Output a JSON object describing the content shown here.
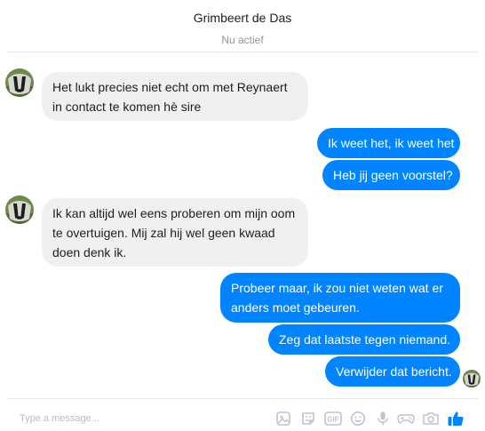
{
  "header": {
    "title": "Grimbeert de Das",
    "status": "Nu actief"
  },
  "messages": [
    {
      "side": "in",
      "text_lines": [
        "Het lukt precies niet echt om met Reynaert",
        "in contact te komen hè sire"
      ]
    },
    {
      "side": "out",
      "text_lines": [
        "Ik weet het, ik weet het"
      ]
    },
    {
      "side": "out",
      "text_lines": [
        "Heb jij geen voorstel?"
      ]
    },
    {
      "side": "in",
      "text_lines": [
        "Ik kan altijd wel eens proberen om mijn oom",
        "te overtuigen. Mij zal hij wel geen kwaad",
        "doen denk ik."
      ]
    },
    {
      "side": "out",
      "text_lines": [
        "Probeer maar, ik zou niet weten wat er",
        "anders moet gebeuren."
      ]
    },
    {
      "side": "out",
      "text_lines": [
        "Zeg dat laatste tegen niemand."
      ]
    },
    {
      "side": "out",
      "text_lines": [
        "Verwijder dat bericht."
      ]
    }
  ],
  "composer": {
    "placeholder": "Type a message...",
    "tools": [
      "sticker-icon",
      "emoji-sticker-icon",
      "gif-icon",
      "emoji-icon",
      "microphone-icon",
      "game-controller-icon",
      "camera-icon",
      "thumbs-up-icon"
    ],
    "gif_label": "GIF"
  },
  "colors": {
    "outgoing_bubble": "#0084ff",
    "incoming_bubble": "#f1f0f0",
    "icon_gray": "#bec2c9"
  }
}
